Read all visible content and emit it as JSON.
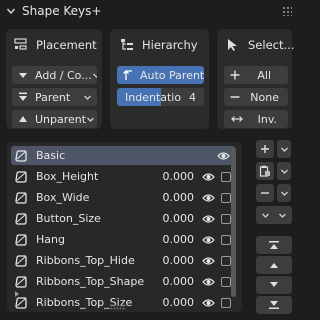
{
  "panel": {
    "title": "Shape Keys+"
  },
  "placement": {
    "header": "Placement",
    "add_label": "Add / Co...",
    "parent_label": "Parent",
    "unparent_label": "Unparent"
  },
  "hierarchy": {
    "header": "Hierarchy",
    "auto_parent_label": "Auto Parent",
    "indentation_label": "Indentatio",
    "indentation_value": "4"
  },
  "select": {
    "header": "Select...",
    "all_label": "All",
    "none_label": "None",
    "invert_label": "Inv."
  },
  "shape_keys": [
    {
      "name": "Basic",
      "value": "",
      "selected": true
    },
    {
      "name": "Box_Height",
      "value": "0.000"
    },
    {
      "name": "Box_Wide",
      "value": "0.000"
    },
    {
      "name": "Button_Size",
      "value": "0.000"
    },
    {
      "name": "Hang",
      "value": "0.000"
    },
    {
      "name": "Ribbons_Top_Hide",
      "value": "0.000"
    },
    {
      "name": "Ribbons_Top_Shape",
      "value": "0.000"
    },
    {
      "name": "Ribbons_Top_Size",
      "value": "0.000"
    }
  ],
  "colors": {
    "panel_bg": "#1d1d1d",
    "box_bg": "#2b2b2b",
    "button_bg": "#3d3d3d",
    "active_blue": "#4772b3",
    "selected_row": "#4e5566"
  }
}
